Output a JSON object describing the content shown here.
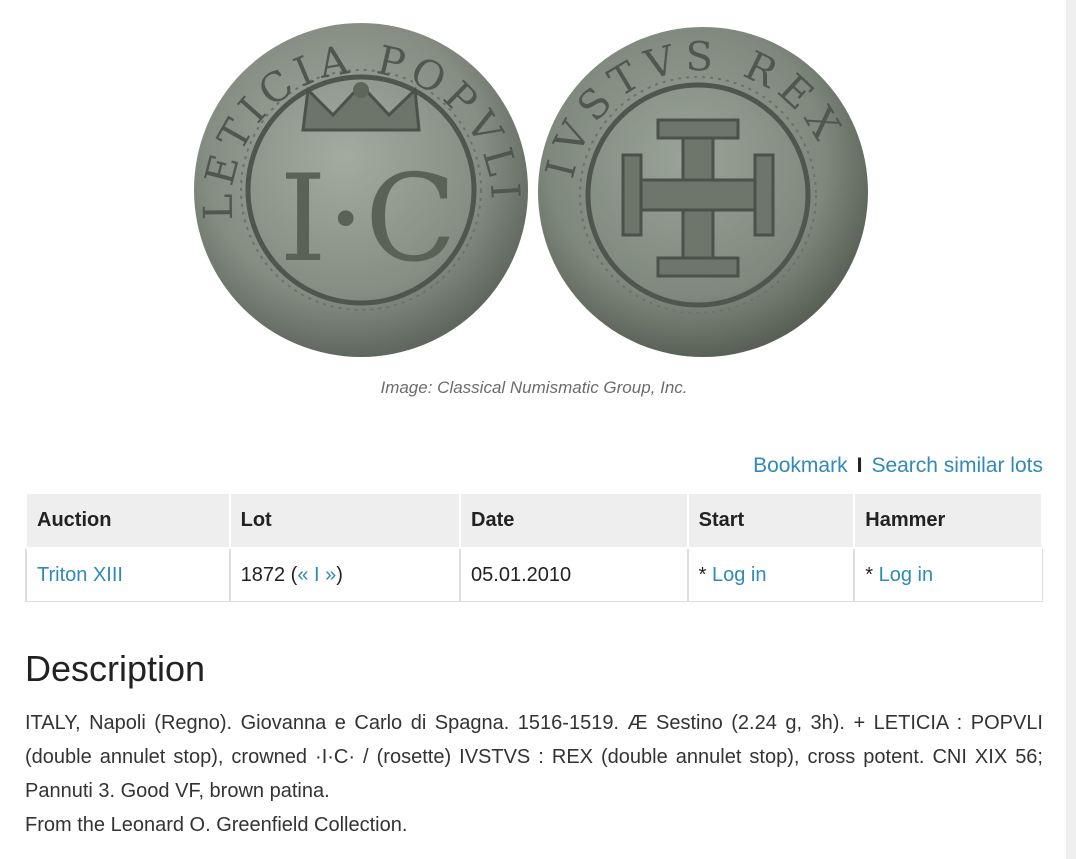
{
  "image": {
    "caption": "Image: Classical Numismatic Group, Inc."
  },
  "actions": {
    "bookmark": "Bookmark",
    "separator": "I",
    "search_similar": "Search similar lots"
  },
  "table": {
    "headers": [
      "Auction",
      "Lot",
      "Date",
      "Start",
      "Hammer"
    ],
    "row": {
      "auction": "Triton XIII",
      "lot_number": "1872 (",
      "lot_prev": "«",
      "lot_sep": " I ",
      "lot_next": "»",
      "lot_close": ")",
      "date": "05.01.2010",
      "start_prefix": "* ",
      "start_link": "Log in",
      "hammer_prefix": "* ",
      "hammer_link": "Log in"
    }
  },
  "description": {
    "title": "Description",
    "text": "ITALY, Napoli (Regno). Giovanna e Carlo di Spagna. 1516-1519. Æ Sestino (2.24 g, 3h). + LETICIA : POPVLI (double annulet stop), crowned ·I·C· / (rosette) IVSTVS : REX (double annulet stop), cross potent. CNI XIX 56; Pannuti 3. Good VF, brown patina.",
    "provenance": "From the Leonard O. Greenfield Collection."
  },
  "coin_legends": {
    "obverse": "LETICIA POPVLI",
    "obverse_monogram": "I·C",
    "reverse": "IVSTVS REX"
  },
  "colors": {
    "link": "#2f8ab9",
    "header_bg": "#eeeeee",
    "coin": "#8d958b"
  }
}
